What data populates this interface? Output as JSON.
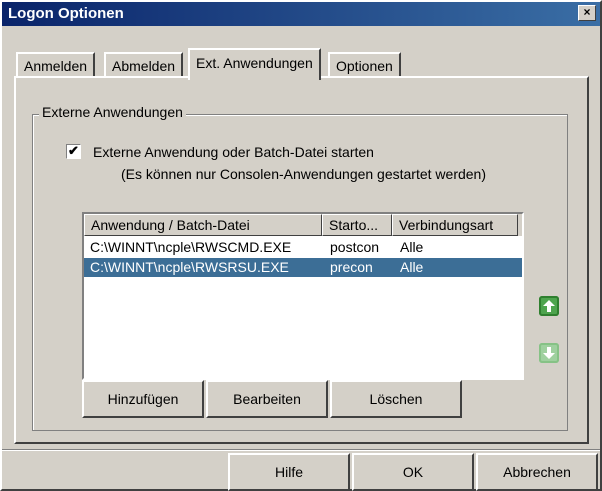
{
  "window": {
    "title": "Logon Optionen",
    "close_glyph": "×"
  },
  "tabs": [
    {
      "label": "Anmelden",
      "active": false
    },
    {
      "label": "Abmelden",
      "active": false
    },
    {
      "label": "Ext. Anwendungen",
      "active": true
    },
    {
      "label": "Optionen",
      "active": false
    }
  ],
  "group": {
    "label": "Externe Anwendungen"
  },
  "checkbox": {
    "checked": true,
    "glyph": "✔",
    "label": "Externe Anwendung oder Batch-Datei starten",
    "hint": "(Es können nur Consolen-Anwendungen gestartet werden)"
  },
  "list": {
    "columns": [
      "Anwendung / Batch-Datei",
      "Starto...",
      "Verbindungsart"
    ],
    "rows": [
      {
        "cells": [
          "C:\\WINNT\\ncple\\RWSCMD.EXE",
          "postcon",
          "Alle"
        ],
        "selected": false
      },
      {
        "cells": [
          "C:\\WINNT\\ncple\\RWSRSU.EXE",
          "precon",
          "Alle"
        ],
        "selected": true
      }
    ]
  },
  "side_buttons": {
    "up_icon": "arrow-up-icon",
    "down_icon": "arrow-down-icon"
  },
  "buttons": {
    "add": "Hinzufügen",
    "edit": "Bearbeiten",
    "delete": "Löschen",
    "help": "Hilfe",
    "ok": "OK",
    "cancel": "Abbrechen"
  },
  "colors": {
    "title_bar": "#0a246a",
    "selection": "#3c6e96",
    "up_arrow": "#4ea44e",
    "down_arrow_disabled": "#9fd09f"
  }
}
